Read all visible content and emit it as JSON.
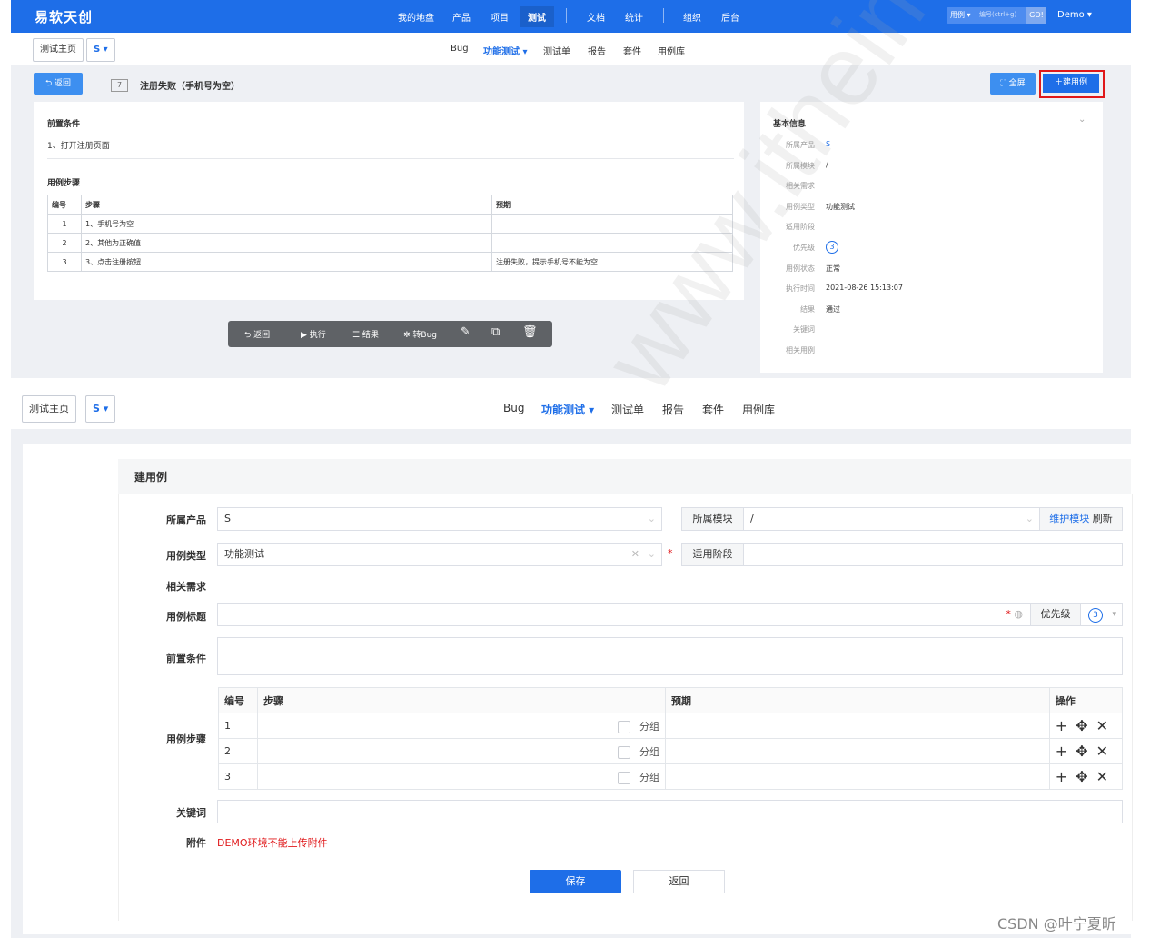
{
  "top": {
    "brand": "易软天创",
    "nav": [
      "我的地盘",
      "产品",
      "项目",
      "测试",
      "文档",
      "统计",
      "组织",
      "后台"
    ],
    "nav_active": "测试",
    "search_type": "用例 ▾",
    "search_placeholder": "编号(ctrl+g)",
    "go": "GO!",
    "user": "Demo ▾",
    "breadcrumb_home": "测试主页",
    "breadcrumb_product": "S ▾",
    "subnav": [
      "Bug",
      "功能测试 ▾",
      "测试单",
      "报告",
      "套件",
      "用例库"
    ],
    "subnav_active": "功能测试 ▾",
    "back_label": "⮌ 返回",
    "case_id": "7",
    "case_title": "注册失败（手机号为空）",
    "fullscreen_label": "⛶ 全屏",
    "create_label": "＋建用例",
    "precondition_title": "前置条件",
    "precondition_text": "1、打开注册页面",
    "steps_title": "用例步骤",
    "steps_headers": [
      "编号",
      "步骤",
      "预期"
    ],
    "steps": [
      {
        "no": "1",
        "step": "1、手机号为空",
        "expect": ""
      },
      {
        "no": "2",
        "step": "2、其他为正确值",
        "expect": ""
      },
      {
        "no": "3",
        "step": "3、点击注册按钮",
        "expect": "注册失败，提示手机号不能为空"
      }
    ],
    "toolbar": {
      "back": "⮌ 返回",
      "run": "▶ 执行",
      "result": "☰ 结果",
      "tobug": "✲ 转Bug"
    },
    "info_title": "基本信息",
    "info": [
      {
        "label": "所属产品",
        "value": "S",
        "link": true
      },
      {
        "label": "所属模块",
        "value": "/"
      },
      {
        "label": "相关需求",
        "value": ""
      },
      {
        "label": "用例类型",
        "value": "功能测试"
      },
      {
        "label": "适用阶段",
        "value": ""
      },
      {
        "label": "优先级",
        "value": "3",
        "circle": true
      },
      {
        "label": "用例状态",
        "value": "正常"
      },
      {
        "label": "执行时间",
        "value": "2021-08-26 15:13:07"
      },
      {
        "label": "结果",
        "value": "通过"
      },
      {
        "label": "关键词",
        "value": ""
      },
      {
        "label": "相关用例",
        "value": ""
      }
    ]
  },
  "bottom": {
    "breadcrumb_home": "测试主页",
    "breadcrumb_product": "S ▾",
    "subnav": [
      "Bug",
      "功能测试 ▾",
      "测试单",
      "报告",
      "套件",
      "用例库"
    ],
    "subnav_active": "功能测试 ▾",
    "form_title": "建用例",
    "product_label": "所属产品",
    "product_value": "S",
    "module_label": "所属模块",
    "module_value": "/",
    "maintain_module": "维护模块",
    "refresh": "刷新",
    "type_label": "用例类型",
    "type_value": "功能测试",
    "stage_label": "适用阶段",
    "story_label": "相关需求",
    "title_label": "用例标题",
    "priority_label": "优先级",
    "priority_value": "3",
    "precondition_label": "前置条件",
    "steps_label": "用例步骤",
    "steps_headers": [
      "编号",
      "步骤",
      "预期",
      "操作"
    ],
    "group_label": "分组",
    "step_numbers": [
      "1",
      "2",
      "3"
    ],
    "keywords_label": "关键词",
    "attach_label": "附件",
    "attach_note": "DEMO环境不能上传附件",
    "save": "保存",
    "back": "返回"
  },
  "watermark": "www.itheima.com",
  "footer": "CSDN @叶宁夏昕",
  "colors": {
    "primary": "#1e6ee8",
    "danger": "#e0181a",
    "toolbar": "#5f6266"
  }
}
